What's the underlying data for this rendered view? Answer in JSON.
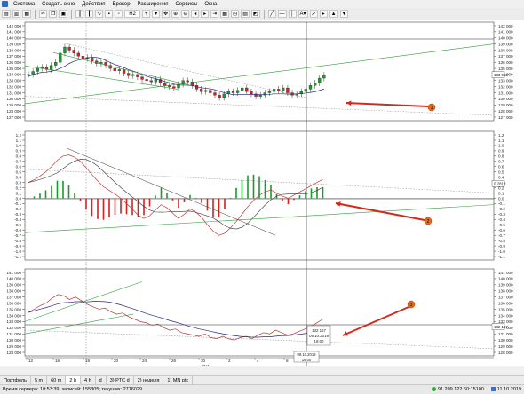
{
  "menu": [
    "Система",
    "Создать окно",
    "Действия",
    "Брокер",
    "Расширения",
    "Сервисы",
    "Окна"
  ],
  "toolbar": {
    "timeframe": "H2",
    "plus": "+",
    "text_tool": "A▾"
  },
  "panels": {
    "price": {
      "ticks": [
        "142 000",
        "141 000",
        "140 000",
        "139 000",
        "138 000",
        "137 000",
        "136 000",
        "135 000",
        "134 000",
        "133 000",
        "132 000",
        "131 000",
        "130 000",
        "129 000",
        "128 000",
        "127 000"
      ],
      "tick_values": [
        142000,
        141000,
        140000,
        139000,
        138000,
        137000,
        136000,
        135000,
        134000,
        133000,
        132000,
        131000,
        130000,
        129000,
        128000,
        127000
      ],
      "left_ticks": [
        "142 000",
        "141 000",
        "140 000",
        "139 000",
        "138 000",
        "137 000",
        "136 000",
        "135 000",
        "134 000",
        "133 000",
        "132 000",
        "131 000",
        "130 000",
        "129 000",
        "128 000",
        "127 000"
      ],
      "last_label": "133 950",
      "annotation": "1"
    },
    "macd": {
      "ticks": [
        "1.2",
        "1.1",
        "1.0",
        "0.9",
        "0.8",
        "0.7",
        "0.6",
        "0.5",
        "0.4",
        "0.3",
        "0.2",
        "0.1",
        "0.0",
        "-0.1",
        "-0.2",
        "-0.3",
        "-0.4",
        "-0.5",
        "-0.6",
        "-0.7",
        "-0.8",
        "-0.9",
        "-1.0",
        "-1.1"
      ],
      "left_ticks": [
        "1.2",
        "1.1",
        "1.0",
        "0.9",
        "0.8",
        "0.7",
        "0.6",
        "0.5",
        "0.4",
        "0.3",
        "0.2",
        "0.1",
        "0.0",
        "-0.1",
        "-0.2",
        "-0.3",
        "-0.4",
        "-0.5",
        "-0.6",
        "-0.7",
        "-0.8",
        "-0.9",
        "-1.0",
        "-1.1"
      ],
      "last_label": "0.2813",
      "annotation": "2"
    },
    "line": {
      "ticks": [
        "141 000",
        "140 000",
        "139 000",
        "138 000",
        "137 000",
        "136 000",
        "135 000",
        "134 000",
        "133 000",
        "132 000",
        "131 000",
        "130 000",
        "129 000",
        "128 000"
      ],
      "left_ticks": [
        "141 000",
        "140 000",
        "139 000",
        "138 000",
        "137 000",
        "136 000",
        "135 000",
        "134 000",
        "133 000",
        "132 000",
        "131 000",
        "130 000",
        "129 000",
        "128 000"
      ],
      "last_label": "132 167",
      "annotation": "3",
      "tooltip": [
        "132 167",
        "09.10.2019",
        "16:00"
      ]
    }
  },
  "xaxis": {
    "labels": [
      "12",
      "16",
      "18",
      "20",
      "24",
      "26",
      "30",
      "2",
      "4",
      "8"
    ],
    "month": "Oct",
    "cursor_date": "09.10.2019",
    "cursor_time": "16:00"
  },
  "tabs": [
    "Портфель",
    "5 m",
    "60 m",
    "2 h",
    "4 h",
    "d",
    "3) PTC d",
    "2) неделя",
    "1) MN ptc"
  ],
  "active_tab": "2 h",
  "status": {
    "left": "Время сервера: 10:53:39; записей: 155305; текущих: 2716029",
    "server": "91.209.122.60:15100",
    "date": "11.10.2019"
  },
  "colors": {
    "candle_up": "#1a9a2e",
    "candle_down": "#d82020",
    "ma": "#2a2a7a",
    "trend": "#2f9f3a",
    "signal": "#c03a3a",
    "arrow": "#d42a1a",
    "annotation_fill": "#e96a1a"
  }
}
